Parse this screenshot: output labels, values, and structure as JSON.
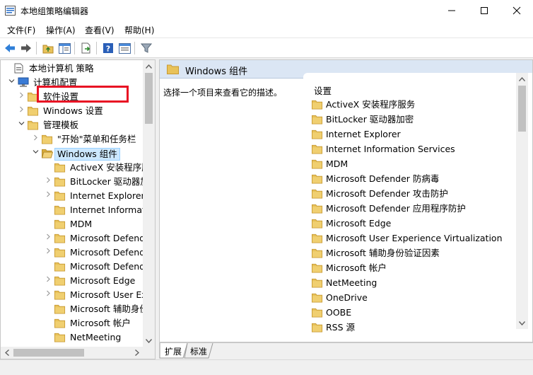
{
  "window": {
    "title": "本地组策略编辑器"
  },
  "menu": [
    "文件(F)",
    "操作(A)",
    "查看(V)",
    "帮助(H)"
  ],
  "toolbar": [
    "back-icon",
    "forward-icon",
    "up-folder-icon",
    "show-hide-tree-icon",
    "export-list-icon",
    "help-icon",
    "properties-icon",
    "filter-icon"
  ],
  "tree": {
    "items": [
      {
        "label": "本地计算机 策略",
        "icon": "computer-policy-icon",
        "expander": ""
      },
      {
        "label": "计算机配置",
        "icon": "computer-icon",
        "expander": "expanded"
      },
      {
        "label": "软件设置",
        "icon": "folder-icon",
        "expander": "collapsed"
      },
      {
        "label": "Windows 设置",
        "icon": "folder-icon",
        "expander": "collapsed"
      },
      {
        "label": "管理模板",
        "icon": "folder-icon",
        "expander": "expanded"
      },
      {
        "label": "\"开始\"菜单和任务栏",
        "icon": "folder-icon",
        "expander": "collapsed"
      },
      {
        "label": "Windows 组件",
        "icon": "folder-open-icon",
        "expander": "expanded",
        "selected": true
      },
      {
        "label": "ActiveX 安装程序服务",
        "icon": "folder-icon",
        "expander": ""
      },
      {
        "label": "BitLocker 驱动器加密",
        "icon": "folder-icon",
        "expander": "collapsed"
      },
      {
        "label": "Internet Explorer",
        "icon": "folder-icon",
        "expander": "collapsed"
      },
      {
        "label": "Internet Information Services",
        "icon": "folder-icon",
        "expander": ""
      },
      {
        "label": "MDM",
        "icon": "folder-icon",
        "expander": ""
      },
      {
        "label": "Microsoft Defender 防病毒",
        "icon": "folder-icon",
        "expander": "collapsed"
      },
      {
        "label": "Microsoft Defender 攻击防护",
        "icon": "folder-icon",
        "expander": "collapsed"
      },
      {
        "label": "Microsoft Defender 应用程序防护",
        "icon": "folder-icon",
        "expander": ""
      },
      {
        "label": "Microsoft Edge",
        "icon": "folder-icon",
        "expander": "collapsed"
      },
      {
        "label": "Microsoft User Experience Virtualization",
        "icon": "folder-icon",
        "expander": "collapsed"
      },
      {
        "label": "Microsoft 辅助身份验证因素",
        "icon": "folder-icon",
        "expander": ""
      },
      {
        "label": "Microsoft 帐户",
        "icon": "folder-icon",
        "expander": ""
      },
      {
        "label": "NetMeeting",
        "icon": "folder-icon",
        "expander": ""
      }
    ]
  },
  "details": {
    "header": "Windows 组件",
    "description": "选择一个项目来查看它的描述。",
    "column_header": "设置",
    "items": [
      "ActiveX 安装程序服务",
      "BitLocker 驱动器加密",
      "Internet Explorer",
      "Internet Information Services",
      "MDM",
      "Microsoft Defender 防病毒",
      "Microsoft Defender 攻击防护",
      "Microsoft Defender 应用程序防护",
      "Microsoft Edge",
      "Microsoft User Experience Virtualization",
      "Microsoft 辅助身份验证因素",
      "Microsoft 帐户",
      "NetMeeting",
      "OneDrive",
      "OOBE",
      "RSS 源"
    ]
  },
  "tabs": [
    {
      "label": "扩展",
      "active": true
    },
    {
      "label": "标准",
      "active": false
    }
  ],
  "colors": {
    "folder": "#e8c25a",
    "selection": "#cce8ff",
    "header_band": "#dbe6f4",
    "highlight_box": "#e81123"
  }
}
